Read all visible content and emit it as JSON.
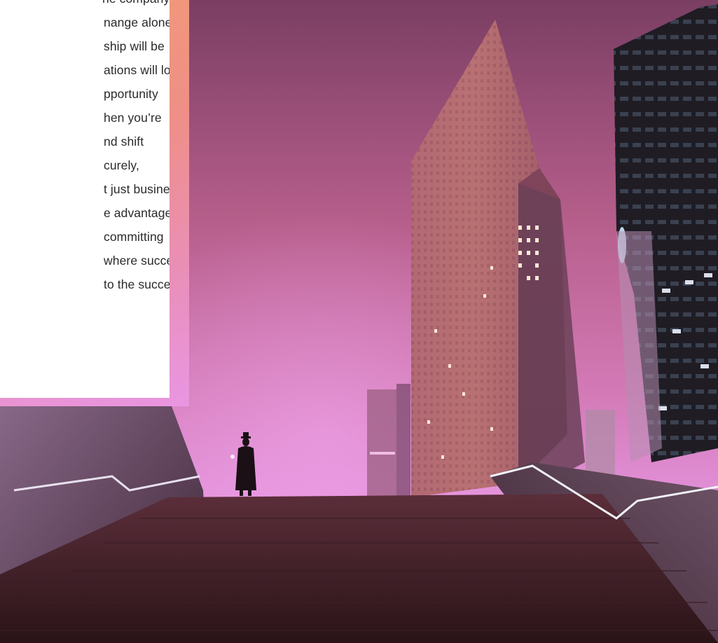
{
  "article": {
    "text_lines": [
      "nange alone,",
      "ship will be",
      "ations will look",
      "pportunity",
      "hen you’re",
      "nd shift",
      "curely,",
      "t just business,",
      "e advantages",
      "committing",
      "where success",
      "to the success"
    ],
    "top_fragment": "ne company"
  },
  "colors": {
    "sky_top": "#7b3e63",
    "sky_mid": "#c46a97",
    "sky_bottom": "#e08ad6",
    "frame_gradient_start": "#f09a78",
    "frame_gradient_end": "#e996e2",
    "window_light": "#ffe9d6"
  },
  "photo": {
    "subject": "night cityscape with fog, skyscrapers and a figure at the top of stairs"
  }
}
